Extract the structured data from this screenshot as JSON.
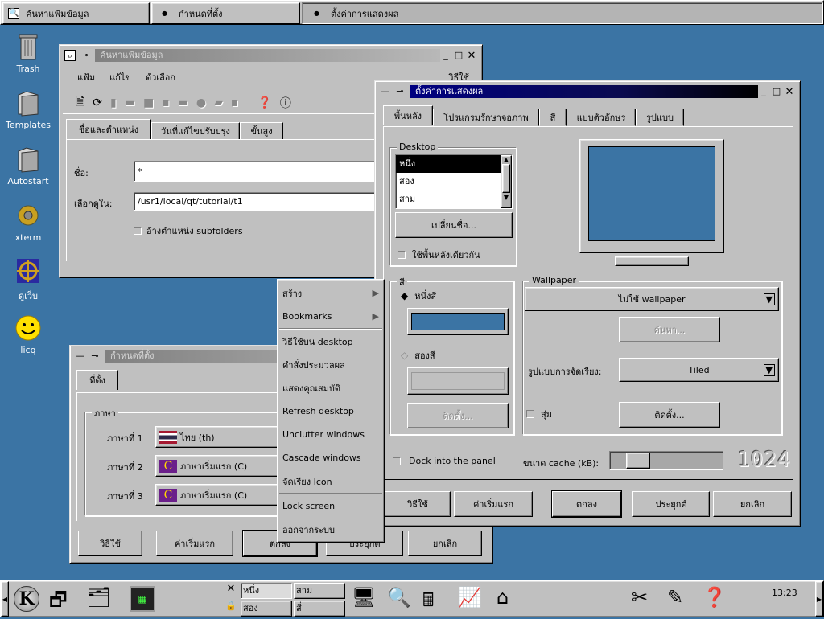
{
  "top_tasks": [
    "ค้นหาแฟ้มข้อมูล",
    "กำหนดที่ตั้ง",
    "ตั้งค่าการแสดงผล"
  ],
  "desktop_icons": [
    "Trash",
    "Templates",
    "Autostart",
    "xterm",
    "ดูเว็บ",
    "licq"
  ],
  "find_window": {
    "title": "ค้นหาแฟ้มข้อมูล",
    "menu": [
      "แฟ้ม",
      "แก้ไข",
      "ตัวเลือก",
      "วิธีใช้"
    ],
    "tabs": [
      "ชื่อและตำแหน่ง",
      "วันที่แก้ไขปรับปรุง",
      "ขั้นสูง"
    ],
    "name_label": "ชื่อ:",
    "name_value": "*",
    "look_in_label": "เลือกดูใน:",
    "look_in_value": "/usr1/local/qt/tutorial/t1",
    "subfolders": "อ้างตำแหน่ง subfolders"
  },
  "locale_window": {
    "title": "กำหนดที่ตั้ง",
    "tab": "ที่ตั้ง",
    "group": "ภาษา",
    "lang1_label": "ภาษาที่ 1",
    "lang1_value": "ไทย (th)",
    "lang2_label": "ภาษาที่ 2",
    "lang2_value": "ภาษาเริ่มแรก (C)",
    "lang3_label": "ภาษาที่ 3",
    "lang3_value": "ภาษาเริ่มแรก (C)",
    "buttons": [
      "วิธีใช้",
      "ค่าเริ่มแรก",
      "ตกลง",
      "ประยุกต์",
      "ยกเลิก"
    ]
  },
  "context_menu": [
    "สร้าง",
    "Bookmarks",
    "วิธีใช้บน desktop",
    "คำสั่งประมวลผล",
    "แสดงคุณสมบัติ",
    "Refresh desktop",
    "Unclutter windows",
    "Cascade windows",
    "จัดเรียง Icon",
    "Lock screen",
    "ออกจากระบบ"
  ],
  "display_window": {
    "title": "ตั้งค่าการแสดงผล",
    "tabs": [
      "พื้นหลัง",
      "โปรแกรมรักษาจอภาพ",
      "สี",
      "แบบตัวอักษร",
      "รูปแบบ"
    ],
    "desktop_group": "Desktop",
    "desktops": [
      "หนึ่ง",
      "สอง",
      "สาม"
    ],
    "rename_button": "เปลี่ยนชื่อ...",
    "same_bg": "ใช้พื้นหลังเดียวกัน",
    "color_group": "สี",
    "color1": "หนึ่งสี",
    "color2": "สองสี",
    "setup_button": "ติดตั้ง...",
    "wallpaper_group": "Wallpaper",
    "wallpaper_select": "ไม่ใช้ wallpaper",
    "browse_button": "ค้นหา...",
    "arrange_label": "รูปแบบการจัดเรียง:",
    "arrange_value": "Tiled",
    "random": "สุ่ม",
    "random_setup": "ติดตั้ง...",
    "dock": "Dock into the panel",
    "cache_label": "ขนาด cache (kB):",
    "cache_value": "1024",
    "buttons": [
      "วิธีใช้",
      "ค่าเริ่มแรก",
      "ตกลง",
      "ประยุกต์",
      "ยกเลิก"
    ],
    "colors": {
      "monitor": "#3b74a4"
    }
  },
  "taskbar": {
    "pager": [
      "หนึ่ง",
      "สาม",
      "สอง",
      "สี่"
    ],
    "clock": "13:23"
  }
}
